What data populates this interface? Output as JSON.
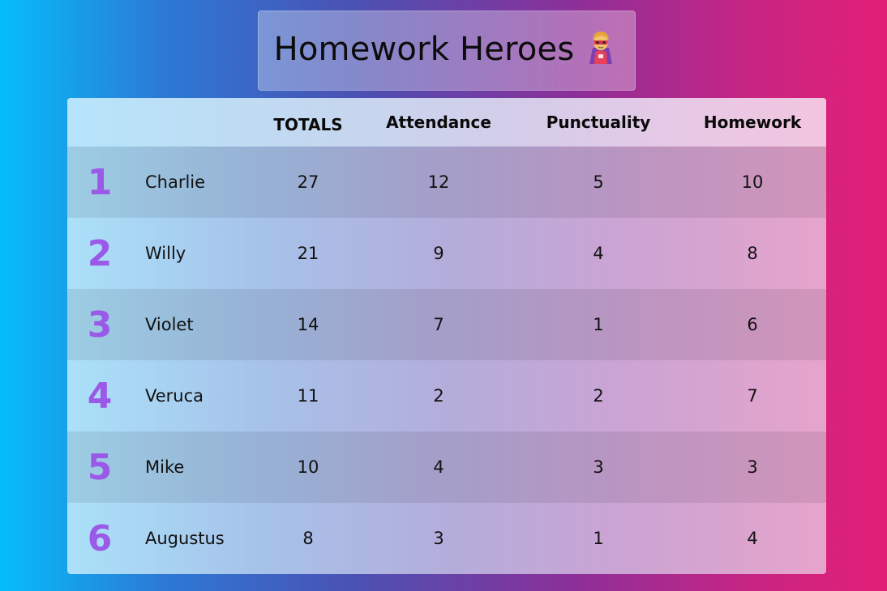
{
  "title": {
    "text": "Homework Heroes",
    "emoji": "🦸"
  },
  "table": {
    "headers": {
      "rank": "",
      "name": "",
      "totals": "TOTALS",
      "attendance": "Attendance",
      "punctuality": "Punctuality",
      "homework": "Homework"
    },
    "rows": [
      {
        "rank": "1",
        "name": "Charlie",
        "totals": "27",
        "attendance": "12",
        "punctuality": "5",
        "homework": "10"
      },
      {
        "rank": "2",
        "name": "Willy",
        "totals": "21",
        "attendance": "9",
        "punctuality": "4",
        "homework": "8"
      },
      {
        "rank": "3",
        "name": "Violet",
        "totals": "14",
        "attendance": "7",
        "punctuality": "1",
        "homework": "6"
      },
      {
        "rank": "4",
        "name": "Veruca",
        "totals": "11",
        "attendance": "2",
        "punctuality": "2",
        "homework": "7"
      },
      {
        "rank": "5",
        "name": "Mike",
        "totals": "10",
        "attendance": "4",
        "punctuality": "3",
        "homework": "3"
      },
      {
        "rank": "6",
        "name": "Augustus",
        "totals": "8",
        "attendance": "3",
        "punctuality": "1",
        "homework": "4"
      }
    ]
  },
  "colors": {
    "rank_color": "#9b59e8",
    "bg_left": "#06bdfa",
    "bg_right": "#e31f76"
  }
}
